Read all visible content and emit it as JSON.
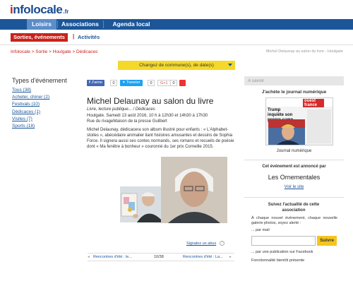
{
  "logo": {
    "i": "i",
    "text": "nfolocale",
    "suffix": ".fr"
  },
  "nav": {
    "tabs": [
      {
        "label": "Loisirs",
        "active": true
      },
      {
        "label": "Associations",
        "active": false
      },
      {
        "label": "Agenda local",
        "active": false
      }
    ]
  },
  "subnav": {
    "active_label": "Sorties, événements",
    "separator": "|",
    "link_label": "Activités"
  },
  "breadcrumb": {
    "text": "Infolocale > Sortie > Houlgate > Dédicaces",
    "right": "Michel Delaunay au salon du livre - Houlgate"
  },
  "change_bar": {
    "label": "Changez de commune(s), de date(s)"
  },
  "sidebar": {
    "title": "Types d'événement",
    "items": [
      "Tous (38)",
      "Acheter, chiner (2)",
      "Festivals (10)",
      "Dédicaces (1)",
      "Visites (7)",
      "Sports (18)"
    ]
  },
  "social": {
    "like": {
      "label": "J'aime",
      "count": "0"
    },
    "tweet": {
      "label": "Tweeter",
      "count": "0"
    },
    "gplus": {
      "label": "G+1",
      "count": "0"
    }
  },
  "article": {
    "title": "Michel Delaunay au salon du livre",
    "tags": "Livre, lecture publique... / Dédicaces",
    "meta_line1": "Houlgate. Samedi 13 août 2016, 10 h à 12h30 et 14h30 à 17h30",
    "meta_line2": "Rue du rivageMaison de la presse Guilbert",
    "body": "Michel Delaunay, dédicacera son album illustré pour enfants : « L'Alphabet-stoiles », abécédaire animalier liant histoires amusantes et dessins de Sophia Force. Il signera aussi ses contes normands, ses romans et recueils de poésie dont « Ma fenêtre à bonheur » couronné du 1er prix Corneille 2015.",
    "report_label": "Signalez un abus",
    "report_icon": "?"
  },
  "pager": {
    "prev": "Rencontres d'été : le...",
    "position": "10/38",
    "next": "Rencontres d'été : La..."
  },
  "right": {
    "asavoir": "A savoir",
    "journal_title": "J'achète le journal numérique",
    "journal_label": "Journal numérique",
    "newspaper": {
      "masthead": "ouest france",
      "headline": "Trump inquiète son propre camp"
    },
    "announced_title": "Cet événement est annoncé par",
    "org_name": "Les Ornementales",
    "org_link": "Voir le site",
    "follow_title": "Suivez l'actualité de cette association",
    "follow_text": "À chaque nouvel événement, chaque nouvelle galerie photos, soyez alerté :",
    "mail_label": "... par mail",
    "mail_button": "Suivre",
    "fb_label": "... par une publication sur Facebook",
    "fb_soon": "Fonctionnalité bientôt présente"
  },
  "colors": {
    "nav_blue": "#1c5699",
    "accent_red": "#c8221c",
    "yellow": "#f4d92b"
  }
}
